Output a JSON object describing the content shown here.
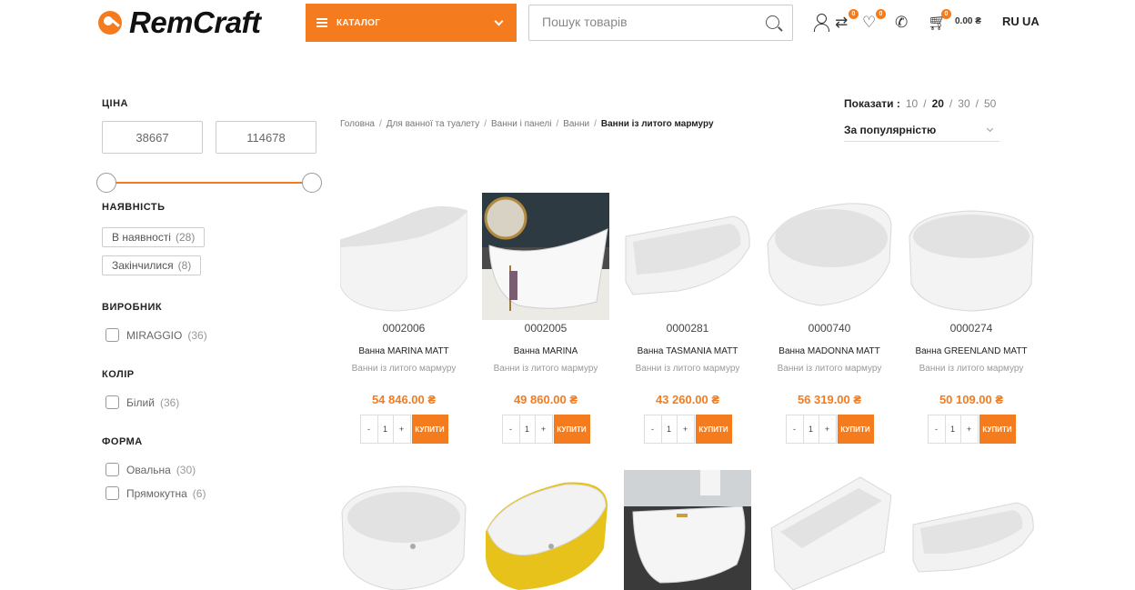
{
  "header": {
    "logo_text": "RemCraft",
    "catalog_label": "КАТАЛОГ",
    "search_placeholder": "Пошук товарів",
    "compare_count": "0",
    "wishlist_count": "0",
    "cart_count": "0",
    "cart_total": "0.00 ₴",
    "lang_ru": "RU",
    "lang_ua": "UA"
  },
  "filters": {
    "price": {
      "title": "ЦІНА",
      "min": "38667",
      "max": "114678",
      "range_min_fraction": 0.0,
      "range_max_fraction": 1.0
    },
    "availability": {
      "title": "НАЯВНІСТЬ",
      "options": [
        {
          "label": "В наявності",
          "count": "(28)"
        },
        {
          "label": "Закінчилися",
          "count": "(8)"
        }
      ]
    },
    "manufacturer": {
      "title": "ВИРОБНИК",
      "options": [
        {
          "label": "MIRAGGIO",
          "count": "(36)"
        }
      ]
    },
    "color": {
      "title": "КОЛІР",
      "options": [
        {
          "label": "Білий",
          "count": "(36)"
        }
      ]
    },
    "shape": {
      "title": "ФОРМА",
      "options": [
        {
          "label": "Овальна",
          "count": "(30)"
        },
        {
          "label": "Прямокутна",
          "count": "(6)"
        }
      ]
    }
  },
  "breadcrumb": [
    "Головна",
    "Для ванної та туалету",
    "Ванни і панелі",
    "Ванни",
    "Ванни із литого мармуру"
  ],
  "toolbar": {
    "show_label": "Показати :",
    "per_page": [
      "10",
      "20",
      "30",
      "50"
    ],
    "per_page_active": "20",
    "sort_label": "За популярністю"
  },
  "products": [
    {
      "code": "0002006",
      "name": "Ванна MARINA MATT",
      "category": "Ванни із литого мармуру",
      "price": "54 846.00 ₴",
      "qty": "1",
      "buy": "КУПИТИ"
    },
    {
      "code": "0002005",
      "name": "Ванна MARINA",
      "category": "Ванни із литого мармуру",
      "price": "49 860.00 ₴",
      "qty": "1",
      "buy": "КУПИТИ"
    },
    {
      "code": "0000281",
      "name": "Ванна TASMANIA MATT",
      "category": "Ванни із литого мармуру",
      "price": "43 260.00 ₴",
      "qty": "1",
      "buy": "КУПИТИ"
    },
    {
      "code": "0000740",
      "name": "Ванна MADONNA MATT",
      "category": "Ванни із литого мармуру",
      "price": "56 319.00 ₴",
      "qty": "1",
      "buy": "КУПИТИ"
    },
    {
      "code": "0000274",
      "name": "Ванна GREENLAND MATT",
      "category": "Ванни із литого мармуру",
      "price": "50 109.00 ₴",
      "qty": "1",
      "buy": "КУПИТИ"
    }
  ],
  "colors": {
    "accent": "#f47c1f",
    "yellow_tub": "#e6c21a"
  }
}
